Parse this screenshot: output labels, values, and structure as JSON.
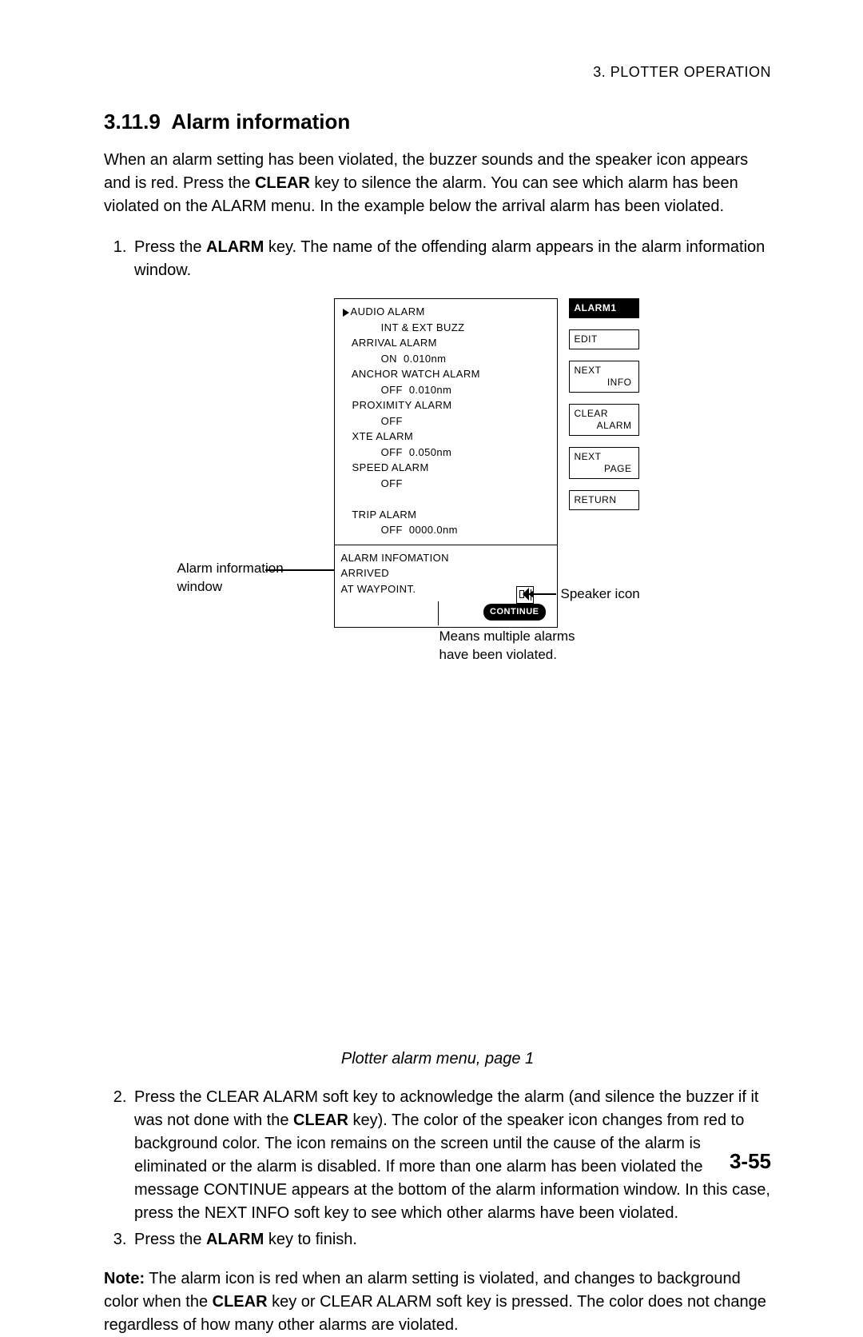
{
  "header": {
    "chapter": "3. PLOTTER OPERATION"
  },
  "section": {
    "number": "3.11.9",
    "title": "Alarm information",
    "intro_a": "When an alarm setting has been violated, the buzzer sounds and the speaker icon appears and is red. Press the ",
    "intro_b_bold": "CLEAR",
    "intro_c": " key to silence the alarm. You can see which alarm has been violated on the ALARM menu. In the example below the arrival alarm has been violated."
  },
  "step1": {
    "a": "Press the ",
    "b_bold": "ALARM",
    "c": " key. The name of the offending alarm appears in the alarm information window."
  },
  "menu": {
    "items": [
      {
        "label": "AUDIO ALARM",
        "value": "INT & EXT BUZZ",
        "cursor": true
      },
      {
        "label": "ARRIVAL ALARM",
        "value": "ON  0.010nm"
      },
      {
        "label": "ANCHOR WATCH ALARM",
        "value": "OFF  0.010nm"
      },
      {
        "label": "PROXIMITY ALARM",
        "value": "OFF"
      },
      {
        "label": "XTE ALARM",
        "value": "OFF  0.050nm"
      },
      {
        "label": "SPEED ALARM",
        "value": "OFF"
      },
      {
        "label": "",
        "value": ""
      },
      {
        "label": "TRIP ALARM",
        "value": "OFF  0000.0nm"
      }
    ],
    "info_title": "ALARM INFOMATION",
    "info_line1": "ARRIVED",
    "info_line2": "AT WAYPOINT.",
    "continue": "CONTINUE"
  },
  "soft_keys": {
    "k1": "ALARM1",
    "k2": "EDIT",
    "k3a": "NEXT",
    "k3b": "INFO",
    "k4a": "CLEAR",
    "k4b": "ALARM",
    "k5a": "NEXT",
    "k5b": "PAGE",
    "k6": "RETURN"
  },
  "callouts": {
    "left1": "Alarm information",
    "left2": "window",
    "speaker": "Speaker icon",
    "continue1": "Means multiple alarms",
    "continue2": "have been violated."
  },
  "figure_caption": "Plotter alarm menu, page 1",
  "step2": {
    "a": "Press the CLEAR ALARM soft key to acknowledge the alarm (and silence the buzzer if it was not done with the ",
    "b_bold": "CLEAR",
    "c": " key). The color of the speaker icon changes from red to background color. The icon remains on the screen until the cause of the alarm is eliminated or the alarm is disabled. If more than one alarm has been violated the message CONTINUE appears at the bottom of the alarm information window. In this case, press the NEXT INFO soft key to see which other alarms have been violated."
  },
  "step3": {
    "a": "Press the ",
    "b_bold": "ALARM",
    "c": " key to finish."
  },
  "note": {
    "label": "Note:",
    "a": " The alarm icon is red when an alarm setting is violated, and changes to background color when the ",
    "b_bold": "CLEAR",
    "c": " key or CLEAR ALARM soft key is pressed. The color does not change regardless of how many other alarms are violated."
  },
  "page_number": "3-55"
}
